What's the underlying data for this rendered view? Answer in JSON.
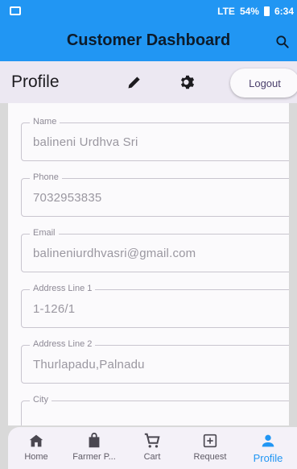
{
  "status_bar": {
    "battery": "54%",
    "time": "6:34",
    "network": "LTE"
  },
  "app_bar": {
    "title": "Customer Dashboard",
    "search_icon": "search-icon"
  },
  "profile_bar": {
    "title": "Profile",
    "logout_label": "Logout"
  },
  "form": {
    "fields": [
      {
        "label": "Name",
        "value": "balineni Urdhva Sri"
      },
      {
        "label": "Phone",
        "value": "7032953835"
      },
      {
        "label": "Email",
        "value": "balineniurdhvasri@gmail.com"
      },
      {
        "label": "Address Line 1",
        "value": "1-126/1"
      },
      {
        "label": "Address Line 2",
        "value": "Thurlapadu,Palnadu"
      },
      {
        "label": "City",
        "value": ""
      }
    ]
  },
  "bottom_nav": {
    "items": [
      {
        "label": "Home",
        "icon": "home-icon"
      },
      {
        "label": "Farmer P...",
        "icon": "shopping-bag-icon"
      },
      {
        "label": "Cart",
        "icon": "cart-icon"
      },
      {
        "label": "Request",
        "icon": "add-box-icon"
      },
      {
        "label": "Profile",
        "icon": "person-icon"
      }
    ],
    "active": "Profile"
  },
  "colors": {
    "primary": "#2196f3",
    "profile_bar_bg": "#ece8f2",
    "surface": "#fbfafc"
  }
}
